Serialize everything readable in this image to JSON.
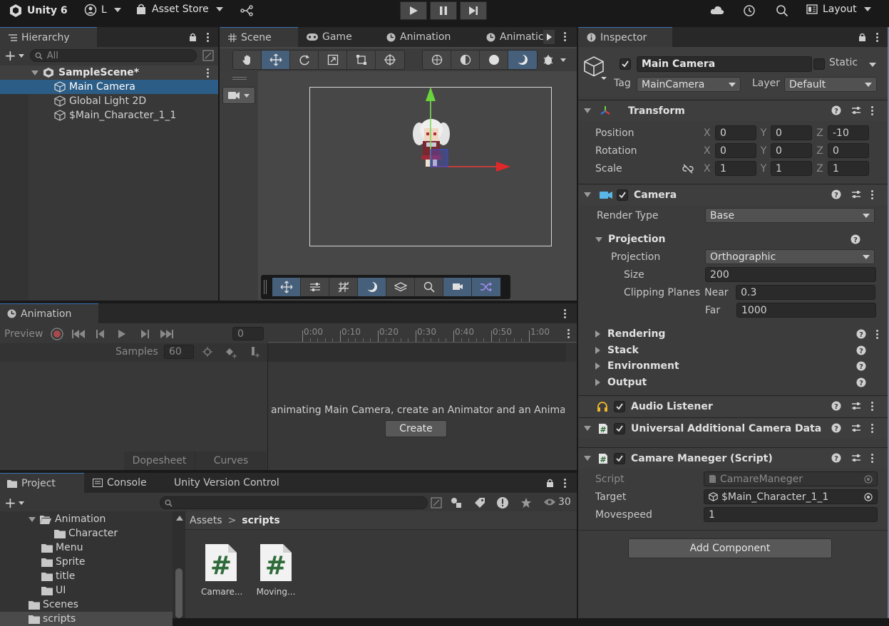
{
  "toolbar": {
    "app": "Unity 6",
    "account": "L",
    "asset_store": "Asset Store",
    "layout": "Layout"
  },
  "hierarchy": {
    "tab": "Hierarchy",
    "search_placeholder": "All",
    "scene": "SampleScene*",
    "items": [
      "Main Camera",
      "Global Light 2D",
      "$Main_Character_1_1"
    ]
  },
  "scene_tabs": [
    "Scene",
    "Game",
    "Animation",
    "Animatic"
  ],
  "animation": {
    "tab": "Animation",
    "preview": "Preview",
    "frame": "0",
    "samples_label": "Samples",
    "samples_value": "60",
    "ticks": [
      "0:00",
      "0:10",
      "0:20",
      "0:30",
      "0:40",
      "0:50",
      "1:00"
    ],
    "message": "animating Main Camera, create an Animator and an Anima",
    "create": "Create",
    "dopesheet": "Dopesheet",
    "curves": "Curves"
  },
  "project": {
    "tabs": [
      "Project",
      "Console",
      "Unity Version Control"
    ],
    "count": "30",
    "tree": [
      "Animation",
      "Character",
      "Menu",
      "Sprite",
      "title",
      "UI",
      "Scenes",
      "scripts"
    ],
    "breadcrumb": [
      "Assets",
      "scripts"
    ],
    "files": [
      "Camare...",
      "Moving..."
    ]
  },
  "inspector": {
    "tab": "Inspector",
    "object_name": "Main Camera",
    "static": "Static",
    "tag_label": "Tag",
    "tag": "MainCamera",
    "layer_label": "Layer",
    "layer": "Default",
    "transform": {
      "title": "Transform",
      "rows": [
        {
          "label": "Position",
          "x": "0",
          "y": "0",
          "z": "-10"
        },
        {
          "label": "Rotation",
          "x": "0",
          "y": "0",
          "z": "0"
        },
        {
          "label": "Scale",
          "x": "1",
          "y": "1",
          "z": "1"
        }
      ],
      "axes": [
        "X",
        "Y",
        "Z"
      ]
    },
    "camera": {
      "title": "Camera",
      "render_type_label": "Render Type",
      "render_type": "Base",
      "projection_header": "Projection",
      "projection_label": "Projection",
      "projection": "Orthographic",
      "size_label": "Size",
      "size": "200",
      "clip_label": "Clipping Planes",
      "near_label": "Near",
      "near": "0.3",
      "far_label": "Far",
      "far": "1000",
      "sections": [
        "Rendering",
        "Stack",
        "Environment",
        "Output"
      ]
    },
    "audio": "Audio Listener",
    "urp": "Universal Additional Camera Data (Sc",
    "script": {
      "title": "Camare Maneger (Script)",
      "script_label": "Script",
      "script_value": "CamareManeger",
      "target_label": "Target",
      "target_value": "$Main_Character_1_1",
      "movespeed_label": "Movespeed",
      "movespeed": "1"
    },
    "add_component": "Add Component"
  },
  "colors": {
    "accent": "#2c5d87",
    "panel": "#383838",
    "tabbar": "#282828"
  }
}
